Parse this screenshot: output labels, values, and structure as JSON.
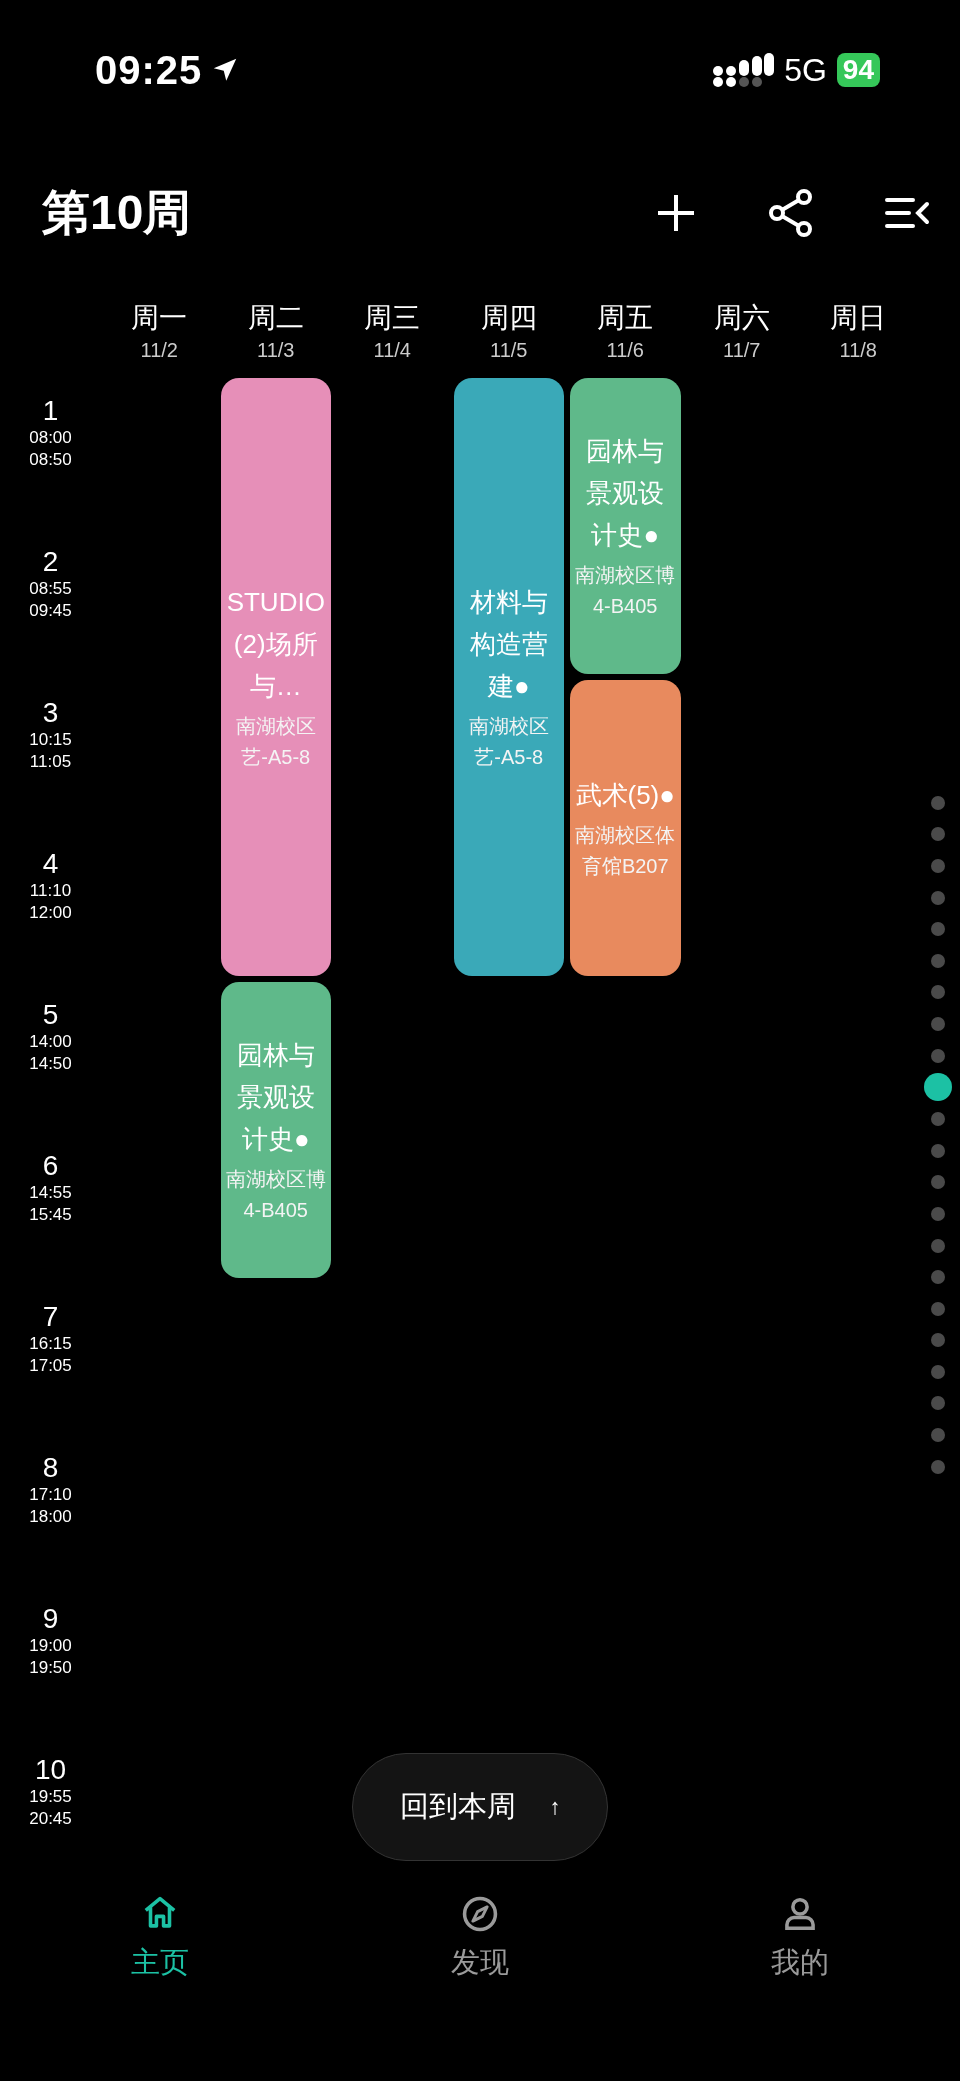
{
  "status_bar": {
    "time": "09:25",
    "network": "5G",
    "battery": "94"
  },
  "header": {
    "title": "第10周"
  },
  "days": [
    {
      "name": "周一",
      "date": "11/2"
    },
    {
      "name": "周二",
      "date": "11/3",
      "slots": [
        {
          "kind": "course",
          "title": "STUDIO(2)场所与…",
          "location": "南湖校区艺-A5-8",
          "color": "#e68fb8"
        },
        {
          "kind": "continued"
        },
        {
          "kind": "continued"
        },
        {
          "kind": "continued"
        },
        {
          "kind": "course",
          "title": "园林与景观设计史●",
          "location": "南湖校区博4-B405",
          "color": "#5fb98a"
        },
        {
          "kind": "continued"
        }
      ]
    },
    {
      "name": "周三",
      "date": "11/4"
    },
    {
      "name": "周四",
      "date": "11/5",
      "slots": [
        {
          "kind": "course",
          "title": "材料与构造营建●",
          "location": "南湖校区艺-A5-8",
          "color": "#3aa9b8"
        },
        {
          "kind": "continued"
        },
        {
          "kind": "continued"
        },
        {
          "kind": "continued"
        }
      ]
    },
    {
      "name": "周五",
      "date": "11/6",
      "slots": [
        {
          "kind": "course",
          "title": "园林与景观设计史●",
          "location": "南湖校区博4-B405",
          "color": "#5fb98a"
        },
        {
          "kind": "continued"
        },
        {
          "kind": "course",
          "title": "武术(5)●",
          "location": "南湖校区体育馆B207",
          "color": "#e88a5e"
        },
        {
          "kind": "continued"
        }
      ]
    },
    {
      "name": "周六",
      "date": "11/7"
    },
    {
      "name": "周日",
      "date": "11/8"
    }
  ],
  "periods": [
    {
      "number": "1",
      "start": "08:00",
      "end": "08:50"
    },
    {
      "number": "2",
      "start": "08:55",
      "end": "09:45"
    },
    {
      "number": "3",
      "start": "10:15",
      "end": "11:05"
    },
    {
      "number": "4",
      "start": "11:10",
      "end": "12:00"
    },
    {
      "number": "5",
      "start": "14:00",
      "end": "14:50"
    },
    {
      "number": "6",
      "start": "14:55",
      "end": "15:45"
    },
    {
      "number": "7",
      "start": "16:15",
      "end": "17:05"
    },
    {
      "number": "8",
      "start": "17:10",
      "end": "18:00"
    },
    {
      "number": "9",
      "start": "19:00",
      "end": "19:50"
    },
    {
      "number": "10",
      "start": "19:55",
      "end": "20:45"
    }
  ],
  "week_dots": [
    {
      "selected": false
    },
    {
      "selected": false
    },
    {
      "selected": false
    },
    {
      "selected": false
    },
    {
      "selected": false
    },
    {
      "selected": false
    },
    {
      "selected": false
    },
    {
      "selected": false
    },
    {
      "selected": false
    },
    {
      "selected": true
    },
    {
      "selected": false
    },
    {
      "selected": false
    },
    {
      "selected": false
    },
    {
      "selected": false
    },
    {
      "selected": false
    },
    {
      "selected": false
    },
    {
      "selected": false
    },
    {
      "selected": false
    },
    {
      "selected": false
    },
    {
      "selected": false
    },
    {
      "selected": false
    },
    {
      "selected": false
    }
  ],
  "back_button": {
    "label": "回到本周",
    "icon": "↑"
  },
  "nav": [
    {
      "label": "主页",
      "selected": true,
      "kind": "home"
    },
    {
      "label": "发现",
      "selected": false,
      "kind": "discover"
    },
    {
      "label": "我的",
      "selected": false,
      "kind": "profile"
    }
  ]
}
